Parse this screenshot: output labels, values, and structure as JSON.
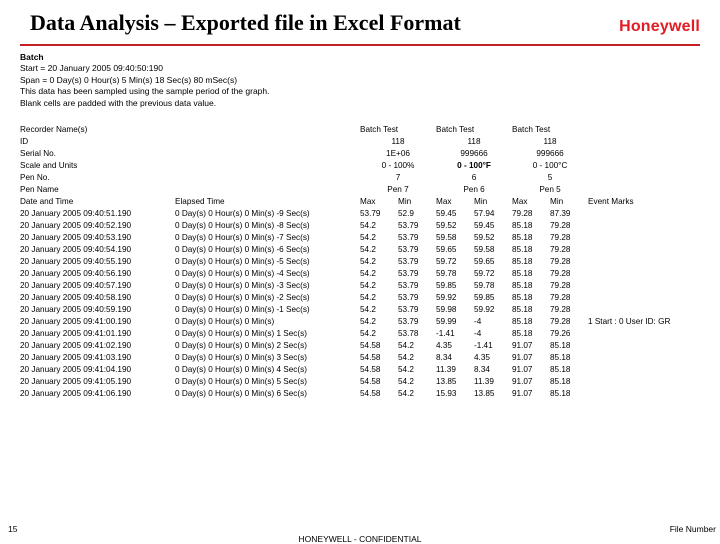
{
  "header": {
    "title": "Data Analysis – Exported file in Excel Format",
    "brand": "Honeywell"
  },
  "intro": {
    "batch": "Batch",
    "start": "Start = 20 January 2005 09:40:50:190",
    "span": "Span = 0 Day(s) 0 Hour(s) 5 Min(s) 18 Sec(s) 80 mSec(s)",
    "note1": "This data has been sampled using the sample period of the graph.",
    "note2": "Blank cells are padded with the previous data value."
  },
  "meta": {
    "labels": {
      "recName": "Recorder Name(s)",
      "id": "ID",
      "serial": "Serial No.",
      "scale": "Scale and Units",
      "penNo": "Pen No.",
      "penName": "Pen Name",
      "dateTime": "Date and Time",
      "elapsed": "Elapsed Time",
      "batchTest": "Batch Test",
      "max": "Max",
      "min": "Min",
      "eventMarks": "Event Marks"
    },
    "col1": {
      "id": "118",
      "serial": "1E+06",
      "scale": "0 - 100%",
      "penNo": "7",
      "penName": "Pen 7"
    },
    "col2": {
      "id": "118",
      "serial": "999666",
      "scale": "0 - 100°F",
      "penNo": "6",
      "penName": "Pen 6"
    },
    "col3": {
      "id": "118",
      "serial": "999666",
      "scale": "0 - 100°C",
      "penNo": "5",
      "penName": "Pen 5"
    }
  },
  "rows": [
    {
      "dt": "20 January 2005 09:40:51.190",
      "el": "0 Day(s) 0 Hour(s) 0 Min(s) -9 Sec(s)",
      "p7max": "53.79",
      "p7min": "52.9",
      "p6max": "59.45",
      "p6min": "57.94",
      "p5max": "79.28",
      "p5min": "87.39",
      "ev": ""
    },
    {
      "dt": "20 January 2005 09:40:52.190",
      "el": "0 Day(s) 0 Hour(s) 0 Min(s) -8 Sec(s)",
      "p7max": "54.2",
      "p7min": "53.79",
      "p6max": "59.52",
      "p6min": "59.45",
      "p5max": "85.18",
      "p5min": "79.28",
      "ev": ""
    },
    {
      "dt": "20 January 2005 09:40:53.190",
      "el": "0 Day(s) 0 Hour(s) 0 Min(s) -7 Sec(s)",
      "p7max": "54.2",
      "p7min": "53.79",
      "p6max": "59.58",
      "p6min": "59.52",
      "p5max": "85.18",
      "p5min": "79.28",
      "ev": ""
    },
    {
      "dt": "20 January 2005 09:40:54.190",
      "el": "0 Day(s) 0 Hour(s) 0 Min(s) -6 Sec(s)",
      "p7max": "54.2",
      "p7min": "53.79",
      "p6max": "59.65",
      "p6min": "59.58",
      "p5max": "85.18",
      "p5min": "79.28",
      "ev": ""
    },
    {
      "dt": "20 January 2005 09:40:55.190",
      "el": "0 Day(s) 0 Hour(s) 0 Min(s) -5 Sec(s)",
      "p7max": "54.2",
      "p7min": "53.79",
      "p6max": "59.72",
      "p6min": "59.65",
      "p5max": "85.18",
      "p5min": "79.28",
      "ev": ""
    },
    {
      "dt": "20 January 2005 09:40:56.190",
      "el": "0 Day(s) 0 Hour(s) 0 Min(s) -4 Sec(s)",
      "p7max": "54.2",
      "p7min": "53.79",
      "p6max": "59.78",
      "p6min": "59.72",
      "p5max": "85.18",
      "p5min": "79.28",
      "ev": ""
    },
    {
      "dt": "20 January 2005 09:40:57.190",
      "el": "0 Day(s) 0 Hour(s) 0 Min(s) -3 Sec(s)",
      "p7max": "54.2",
      "p7min": "53.79",
      "p6max": "59.85",
      "p6min": "59.78",
      "p5max": "85.18",
      "p5min": "79.28",
      "ev": ""
    },
    {
      "dt": "20 January 2005 09:40:58.190",
      "el": "0 Day(s) 0 Hour(s) 0 Min(s) -2 Sec(s)",
      "p7max": "54.2",
      "p7min": "53.79",
      "p6max": "59.92",
      "p6min": "59.85",
      "p5max": "85.18",
      "p5min": "79.28",
      "ev": ""
    },
    {
      "dt": "20 January 2005 09:40:59.190",
      "el": "0 Day(s) 0 Hour(s) 0 Min(s) -1 Sec(s)",
      "p7max": "54.2",
      "p7min": "53.79",
      "p6max": "59.98",
      "p6min": "59.92",
      "p5max": "85.18",
      "p5min": "79.28",
      "ev": ""
    },
    {
      "dt": "20 January 2005 09:41:00.190",
      "el": "0 Day(s) 0 Hour(s) 0 Min(s)",
      "p7max": "54.2",
      "p7min": "53.79",
      "p6max": "59.99",
      "p6min": "-4",
      "p5max": "85.18",
      "p5min": "79.28",
      "ev": "1 Start : 0 User ID: GR"
    },
    {
      "dt": "20 January 2005 09:41:01.190",
      "el": "0 Day(s) 0 Hour(s) 0 Min(s) 1 Sec(s)",
      "p7max": "54.2",
      "p7min": "53.78",
      "p6max": "-1.41",
      "p6min": "-4",
      "p5max": "85.18",
      "p5min": "79.26",
      "ev": ""
    },
    {
      "dt": "20 January 2005 09:41:02.190",
      "el": "0 Day(s) 0 Hour(s) 0 Min(s) 2 Sec(s)",
      "p7max": "54.58",
      "p7min": "54.2",
      "p6max": "4.35",
      "p6min": "-1.41",
      "p5max": "91.07",
      "p5min": "85.18",
      "ev": ""
    },
    {
      "dt": "20 January 2005 09:41:03.190",
      "el": "0 Day(s) 0 Hour(s) 0 Min(s) 3 Sec(s)",
      "p7max": "54.58",
      "p7min": "54.2",
      "p6max": "8.34",
      "p6min": "4.35",
      "p5max": "91.07",
      "p5min": "85.18",
      "ev": ""
    },
    {
      "dt": "20 January 2005 09:41:04.190",
      "el": "0 Day(s) 0 Hour(s) 0 Min(s) 4 Sec(s)",
      "p7max": "54.58",
      "p7min": "54.2",
      "p6max": "11.39",
      "p6min": "8.34",
      "p5max": "91.07",
      "p5min": "85.18",
      "ev": ""
    },
    {
      "dt": "20 January 2005 09:41:05.190",
      "el": "0 Day(s) 0 Hour(s) 0 Min(s) 5 Sec(s)",
      "p7max": "54.58",
      "p7min": "54.2",
      "p6max": "13.85",
      "p6min": "11.39",
      "p5max": "91.07",
      "p5min": "85.18",
      "ev": ""
    },
    {
      "dt": "20 January 2005 09:41:06.190",
      "el": "0 Day(s) 0 Hour(s) 0 Min(s) 6 Sec(s)",
      "p7max": "54.58",
      "p7min": "54.2",
      "p6max": "15.93",
      "p6min": "13.85",
      "p5max": "91.07",
      "p5min": "85.18",
      "ev": ""
    }
  ],
  "footer": {
    "slide": "15",
    "conf": "HONEYWELL - CONFIDENTIAL",
    "file": "File Number"
  }
}
